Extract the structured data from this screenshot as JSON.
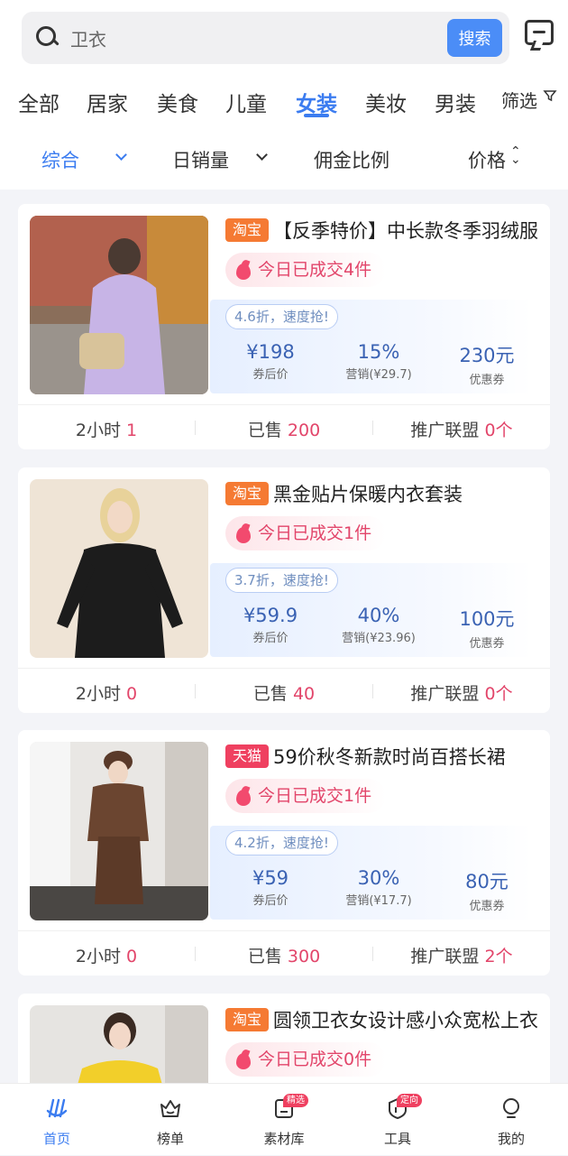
{
  "search": {
    "value": "卫衣",
    "button_label": "搜索"
  },
  "categories": {
    "items": [
      "全部",
      "居家",
      "美食",
      "儿童",
      "女装",
      "美妆",
      "男装"
    ],
    "active": "女装",
    "filter_label": "筛选"
  },
  "sort": {
    "items": [
      "综合",
      "日销量",
      "佣金比例",
      "价格"
    ],
    "active": "综合"
  },
  "products": [
    {
      "platform": "淘宝",
      "title": "【反季特价】中长款冬季羽绒服",
      "today_deals": "今日已成交4件",
      "discount": "4.6折，速度抢!",
      "price": "¥198",
      "price_label": "券后价",
      "commission": "15%",
      "commission_label": "营销(¥29.7)",
      "coupon": "230元",
      "coupon_label": "优惠券",
      "hours_label": "2小时",
      "hours_value": "1",
      "sold_label": "已售",
      "sold_value": "200",
      "alliance_label": "推广联盟",
      "alliance_value": "0个"
    },
    {
      "platform": "淘宝",
      "title": "黑金贴片保暖内衣套装",
      "today_deals": "今日已成交1件",
      "discount": "3.7折，速度抢!",
      "price": "¥59.9",
      "price_label": "券后价",
      "commission": "40%",
      "commission_label": "营销(¥23.96)",
      "coupon": "100元",
      "coupon_label": "优惠券",
      "hours_label": "2小时",
      "hours_value": "0",
      "sold_label": "已售",
      "sold_value": "40",
      "alliance_label": "推广联盟",
      "alliance_value": "0个"
    },
    {
      "platform": "天猫",
      "title": "59价秋冬新款时尚百搭长裙",
      "today_deals": "今日已成交1件",
      "discount": "4.2折，速度抢!",
      "price": "¥59",
      "price_label": "券后价",
      "commission": "30%",
      "commission_label": "营销(¥17.7)",
      "coupon": "80元",
      "coupon_label": "优惠券",
      "hours_label": "2小时",
      "hours_value": "0",
      "sold_label": "已售",
      "sold_value": "300",
      "alliance_label": "推广联盟",
      "alliance_value": "2个"
    },
    {
      "platform": "淘宝",
      "title": "圆领卫衣女设计感小众宽松上衣",
      "today_deals": "今日已成交0件"
    }
  ],
  "tabbar": {
    "items": [
      {
        "label": "首页",
        "icon": "home-icon",
        "badge": ""
      },
      {
        "label": "榜单",
        "icon": "ranking-icon",
        "badge": ""
      },
      {
        "label": "素材库",
        "icon": "material-icon",
        "badge": "精选"
      },
      {
        "label": "工具",
        "icon": "tools-icon",
        "badge": "定向"
      },
      {
        "label": "我的",
        "icon": "profile-icon",
        "badge": ""
      }
    ],
    "active": "首页"
  },
  "colors": {
    "accent": "#3b7cf0",
    "search_button": "#4b8df7",
    "highlight_pink": "#e2456a",
    "taobao_tag": "#f57a33",
    "tmall_tag": "#ef4060"
  }
}
